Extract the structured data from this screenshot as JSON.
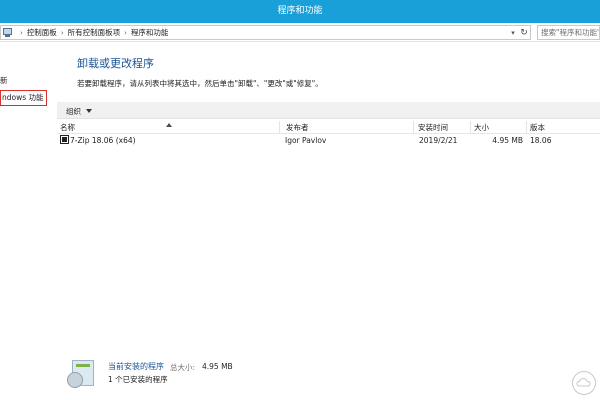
{
  "window": {
    "title": "程序和功能"
  },
  "address": {
    "crumbs": [
      "控制面板",
      "所有控制面板项",
      "程序和功能"
    ],
    "search_placeholder": "搜索\"程序和功能\""
  },
  "left_pane": {
    "links": [
      "新",
      "ndows 功能"
    ]
  },
  "main": {
    "title": "卸载或更改程序",
    "subtitle": "若要卸载程序，请从列表中将其选中，然后单击\"卸载\"、\"更改\"或\"修复\"。"
  },
  "toolbar": {
    "organize_label": "组织"
  },
  "table": {
    "columns": [
      "名称",
      "发布者",
      "安装时间",
      "大小",
      "版本"
    ],
    "rows": [
      {
        "name": "7-Zip 18.06 (x64)",
        "publisher": "Igor Pavlov",
        "installed": "2019/2/21",
        "size": "4.95 MB",
        "version": "18.06"
      }
    ]
  },
  "footer": {
    "title": "当前安装的程序",
    "total_label": "总大小:",
    "total_size": "4.95 MB",
    "count_text": "1 个已安装的程序"
  },
  "colors": {
    "titlebar": "#19a0d8",
    "heading_blue": "#1b5596",
    "highlight_red": "#d8302d"
  }
}
